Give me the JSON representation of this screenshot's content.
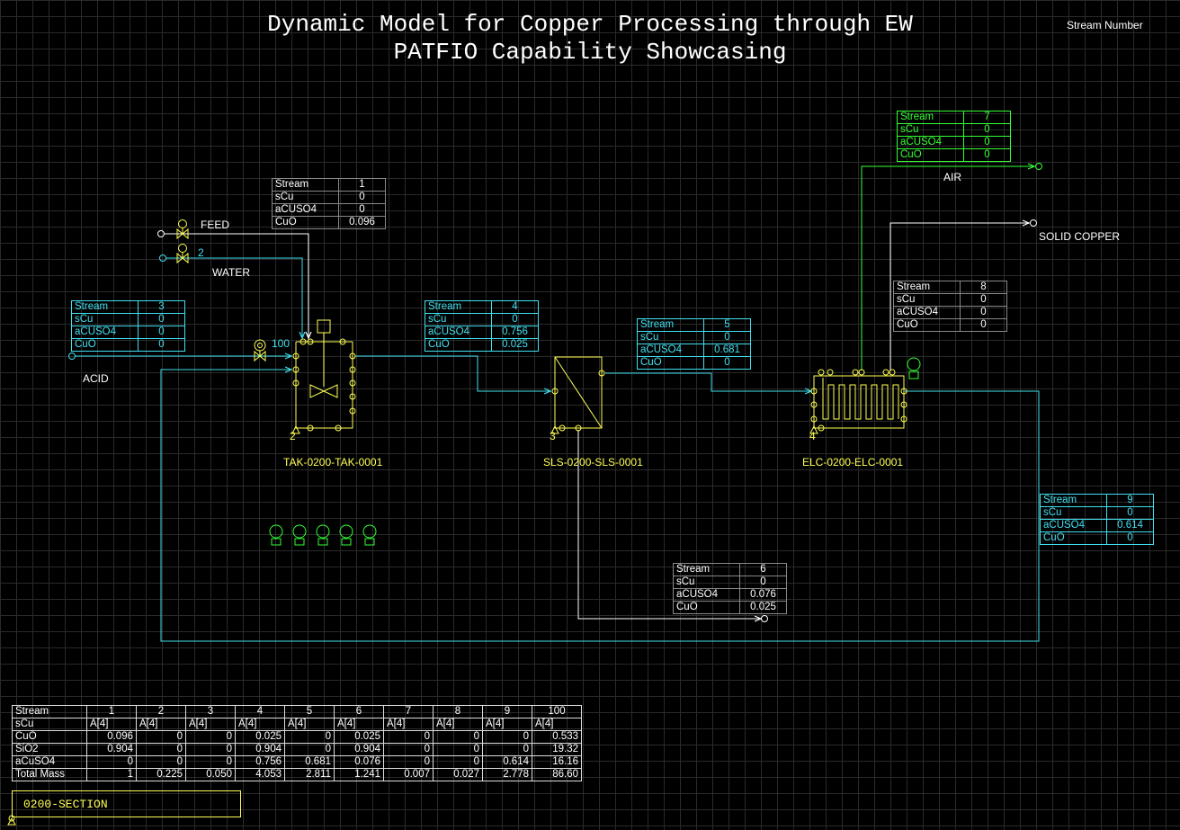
{
  "title": {
    "line1": "Dynamic Model for Copper Processing through EW",
    "line2": "PATFIO Capability Showcasing"
  },
  "legend_label": "Stream Number",
  "section_label": "0200-SECTION",
  "colors": {
    "background": "#000000",
    "grid": "#2a2a2a",
    "stream_line": "#40e0f0",
    "equipment": "#ffff55",
    "air_line": "#33ff33",
    "feed_line": "#ffffff"
  },
  "units": {
    "tank": {
      "tag": "TAK-0200-TAK-0001",
      "number": "2",
      "icon": "stirred-tank-icon"
    },
    "separator": {
      "tag": "SLS-0200-SLS-0001",
      "number": "3",
      "icon": "solid-liquid-separator-icon"
    },
    "cell": {
      "tag": "ELC-0200-ELC-0001",
      "number": "4",
      "icon": "electrowinning-cell-icon"
    }
  },
  "terminals": {
    "feed": "FEED",
    "water": "WATER",
    "acid": "ACID",
    "air": "AIR",
    "solid_copper": "SOLID COPPER"
  },
  "stream_tags": {
    "water_number": "2",
    "acid_number": "100"
  },
  "stream_boxes": {
    "s1": {
      "rows": [
        [
          "Stream",
          "1"
        ],
        [
          "sCu",
          "0"
        ],
        [
          "aCUSO4",
          "0"
        ],
        [
          "CuO",
          "0.096"
        ]
      ]
    },
    "s3": {
      "rows": [
        [
          "Stream",
          "3"
        ],
        [
          "sCu",
          "0"
        ],
        [
          "aCUSO4",
          "0"
        ],
        [
          "CuO",
          "0"
        ]
      ]
    },
    "s4": {
      "rows": [
        [
          "Stream",
          "4"
        ],
        [
          "sCu",
          "0"
        ],
        [
          "aCUSO4",
          "0.756"
        ],
        [
          "CuO",
          "0.025"
        ]
      ]
    },
    "s5": {
      "rows": [
        [
          "Stream",
          "5"
        ],
        [
          "sCu",
          "0"
        ],
        [
          "aCUSO4",
          "0.681"
        ],
        [
          "CuO",
          "0"
        ]
      ]
    },
    "s6": {
      "rows": [
        [
          "Stream",
          "6"
        ],
        [
          "sCu",
          "0"
        ],
        [
          "aCUSO4",
          "0.076"
        ],
        [
          "CuO",
          "0.025"
        ]
      ]
    },
    "s7": {
      "rows": [
        [
          "Stream",
          "7"
        ],
        [
          "sCu",
          "0"
        ],
        [
          "aCUSO4",
          "0"
        ],
        [
          "CuO",
          "0"
        ]
      ]
    },
    "s8": {
      "rows": [
        [
          "Stream",
          "8"
        ],
        [
          "sCu",
          "0"
        ],
        [
          "aCUSO4",
          "0"
        ],
        [
          "CuO",
          "0"
        ]
      ]
    },
    "s9": {
      "rows": [
        [
          "Stream",
          "9"
        ],
        [
          "sCu",
          "0"
        ],
        [
          "aCUSO4",
          "0.614"
        ],
        [
          "CuO",
          "0"
        ]
      ]
    }
  },
  "summary_table": {
    "header": [
      "Stream",
      "1",
      "2",
      "3",
      "4",
      "5",
      "6",
      "7",
      "8",
      "9",
      "100"
    ],
    "rows": [
      [
        "sCu",
        "A[4]",
        "A[4]",
        "A[4]",
        "A[4]",
        "A[4]",
        "A[4]",
        "A[4]",
        "A[4]",
        "A[4]",
        "A[4]"
      ],
      [
        "CuO",
        "0.096",
        "0",
        "0",
        "0.025",
        "0",
        "0.025",
        "0",
        "0",
        "0",
        "0.533"
      ],
      [
        "SiO2",
        "0.904",
        "0",
        "0",
        "0.904",
        "0",
        "0.904",
        "0",
        "0",
        "0",
        "19.32"
      ],
      [
        "aCuSO4",
        "0",
        "0",
        "0",
        "0.756",
        "0.681",
        "0.076",
        "0",
        "0",
        "0.614",
        "16.16"
      ],
      [
        "Total Mass",
        "1",
        "0.225",
        "0.050",
        "4.053",
        "2.811",
        "1.241",
        "0.007",
        "0.027",
        "2.778",
        "86.60"
      ]
    ]
  }
}
